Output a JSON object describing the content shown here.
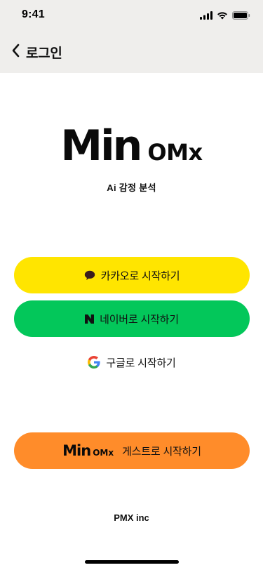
{
  "status_bar": {
    "time": "9:41",
    "icons": [
      "cellular-signal-icon",
      "wifi-icon",
      "battery-icon"
    ]
  },
  "nav": {
    "back_icon": "chevron-left-icon",
    "title": "로그인"
  },
  "logo": {
    "main": "Min",
    "sub": "OMx",
    "tagline": "Ai 감정 분석"
  },
  "buttons": {
    "kakao": {
      "label": "카카오로 시작하기",
      "icon": "kakao-chat-bubble-icon",
      "color": "#ffe500"
    },
    "naver": {
      "label": "네이버로 시작하기",
      "icon": "naver-n-icon",
      "color": "#03c75a"
    },
    "google": {
      "label": "구글로 시작하기",
      "icon": "google-g-icon"
    },
    "guest": {
      "logo_main": "Min",
      "logo_sub": "OMx",
      "label": "게스트로 시작하기",
      "color": "#ff8c2a"
    }
  },
  "footer": {
    "text": "PMX inc"
  }
}
